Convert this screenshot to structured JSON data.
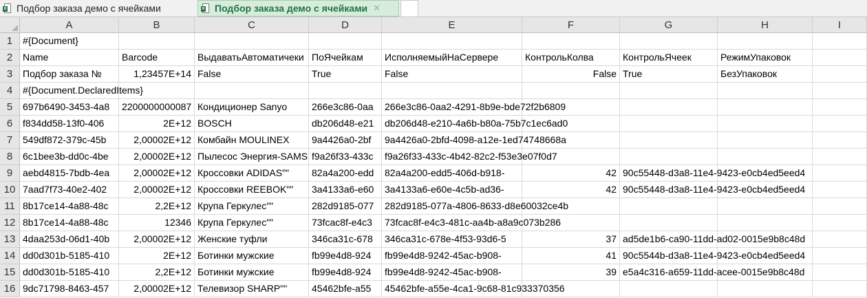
{
  "tabs": [
    {
      "label": "Подбор заказа демо с ячейками",
      "active": false
    },
    {
      "label": "Подбор заказа демо с ячейками",
      "active": true,
      "close": "✕"
    }
  ],
  "columns": [
    "A",
    "B",
    "C",
    "D",
    "E",
    "F",
    "G",
    "H",
    "I"
  ],
  "rows": [
    {
      "num": "1",
      "cells": [
        "#{Document}",
        "",
        "",
        "",
        "",
        "",
        "",
        "",
        ""
      ]
    },
    {
      "num": "2",
      "cells": [
        "Name",
        "Barcode",
        "ВыдаватьАвтоматичеки",
        "ПоЯчейкам",
        "ИсполняемыйНаСервере",
        "КонтрольКолва",
        "КонтрольЯчеек",
        "РежимУпаковок",
        ""
      ]
    },
    {
      "num": "3",
      "cells": [
        "Подбор заказа №",
        "1,23457E+14",
        "False",
        "True",
        "False",
        "False",
        "True",
        "БезУпаковок",
        ""
      ]
    },
    {
      "num": "4",
      "cells": [
        "#{Document.DeclaredItems}",
        "",
        "",
        "",
        "",
        "",
        "",
        "",
        ""
      ]
    },
    {
      "num": "5",
      "cells": [
        "697b6490-3453-4a8",
        "2200000000087",
        "Кондиционер Sanyo",
        "266e3c86-0aa",
        "266e3c86-0aa2-4291-8b9e-bde72f2b6809",
        "",
        "",
        "",
        ""
      ]
    },
    {
      "num": "6",
      "cells": [
        "f834dd58-13f0-406",
        "2E+12",
        "BOSCH",
        "db206d48-e21",
        "db206d48-e210-4a6b-b80a-75b7c1ec6ad0",
        "",
        "",
        "",
        ""
      ]
    },
    {
      "num": "7",
      "cells": [
        "549df872-379c-45b",
        "2,00002E+12",
        "Комбайн MOULINEX",
        "9a4426a0-2bf",
        "9a4426a0-2bfd-4098-a12e-1ed74748668a",
        "",
        "",
        "",
        ""
      ]
    },
    {
      "num": "8",
      "cells": [
        "6c1bee3b-dd0c-4be",
        "2,00002E+12",
        "Пылесос Энергия-SAMSUNG",
        "f9a26f33-433c",
        "f9a26f33-433c-4b42-82c2-f53e3e07f0d7",
        "",
        "",
        "",
        ""
      ]
    },
    {
      "num": "9",
      "cells": [
        "aebd4815-7bdb-4ea",
        "2,00002E+12",
        "Кроссовки ADIDAS\"\"",
        "82a4a200-edd",
        "82a4a200-edd5-406d-b918-",
        "42",
        "90c55448-d3a8-11e4-9423-e0cb4ed5eed4",
        "",
        ""
      ]
    },
    {
      "num": "10",
      "cells": [
        "7aad7f73-40e2-402",
        "2,00002E+12",
        "Кроссовки REEBOK\"\"",
        "3a4133a6-e60",
        "3a4133a6-e60e-4c5b-ad36-",
        "42",
        "90c55448-d3a8-11e4-9423-e0cb4ed5eed4",
        "",
        ""
      ]
    },
    {
      "num": "11",
      "cells": [
        "8b17ce14-4a88-48c",
        "2,2E+12",
        "Крупа Геркулес\"\"",
        "282d9185-077",
        "282d9185-077a-4806-8633-d8e60032ce4b",
        "",
        "",
        "",
        ""
      ]
    },
    {
      "num": "12",
      "cells": [
        "8b17ce14-4a88-48c",
        "12346",
        "Крупа Геркулес\"\"",
        "73fcac8f-e4c3",
        "73fcac8f-e4c3-481c-aa4b-a8a9c073b286",
        "",
        "",
        "",
        ""
      ]
    },
    {
      "num": "13",
      "cells": [
        "4daa253d-06d1-40b",
        "2,00002E+12",
        "Женские туфли",
        "346ca31c-678",
        "346ca31c-678e-4f53-93d6-5",
        "37",
        "ad5de1b6-ca90-11dd-ad02-0015e9b8c48d",
        "",
        ""
      ]
    },
    {
      "num": "14",
      "cells": [
        "dd0d301b-5185-410",
        "2E+12",
        "Ботинки мужские",
        "fb99e4d8-924",
        "fb99e4d8-9242-45ac-b908-",
        "41",
        "90c5544b-d3a8-11e4-9423-e0cb4ed5eed4",
        "",
        ""
      ]
    },
    {
      "num": "15",
      "cells": [
        "dd0d301b-5185-410",
        "2,2E+12",
        "Ботинки мужские",
        "fb99e4d8-924",
        "fb99e4d8-9242-45ac-b908-",
        "39",
        "e5a4c316-a659-11dd-acee-0015e9b8c48d",
        "",
        ""
      ]
    },
    {
      "num": "16",
      "cells": [
        "9dc71798-8463-457",
        "2,00002E+12",
        "Телевизор SHARP\"\"",
        "45462bfe-a55",
        "45462bfe-a55e-4ca1-9c68-81c933370356",
        "",
        "",
        "",
        ""
      ]
    }
  ]
}
